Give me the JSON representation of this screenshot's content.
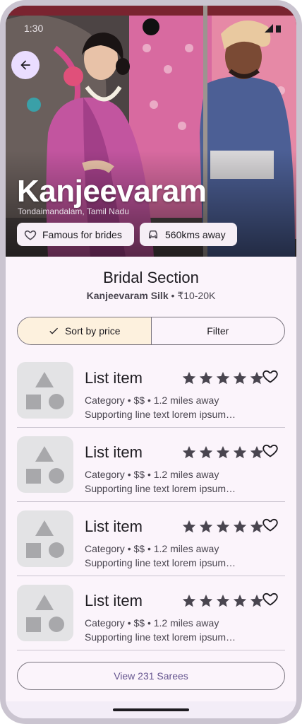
{
  "status": {
    "time": "1:30"
  },
  "hero": {
    "title": "Kanjeevaram",
    "location": "Tondaimandalam, Tamil Nadu",
    "chips": [
      {
        "label": "Famous for brides",
        "icon": "heart-outline-icon"
      },
      {
        "label": "560kms away",
        "icon": "car-icon"
      }
    ]
  },
  "section": {
    "title": "Bridal Section",
    "subtitle_bold": "Kanjeevaram Silk",
    "subtitle_rest": " • ₹10-20K"
  },
  "segmented": {
    "sort_label": "Sort by price",
    "filter_label": "Filter"
  },
  "list": {
    "items": [
      {
        "title": "List item",
        "meta": "Category • $$ • 1.2 miles away",
        "line": "Supporting line text lorem ipsum…",
        "rating": 5
      },
      {
        "title": "List item",
        "meta": "Category • $$ • 1.2 miles away",
        "line": "Supporting line text lorem ipsum…",
        "rating": 5
      },
      {
        "title": "List item",
        "meta": "Category • $$ • 1.2 miles away",
        "line": "Supporting line text lorem ipsum…",
        "rating": 5
      },
      {
        "title": "List item",
        "meta": "Category • $$ • 1.2 miles away",
        "line": "Supporting line text lorem ipsum…",
        "rating": 5
      }
    ]
  },
  "view_button": {
    "label": "View 231 Sarees"
  },
  "colors": {
    "accent": "#65558f",
    "chip_bg": "#f6eff6",
    "active_segment": "#fdf1de",
    "screen_bg": "#fbf4fb"
  }
}
